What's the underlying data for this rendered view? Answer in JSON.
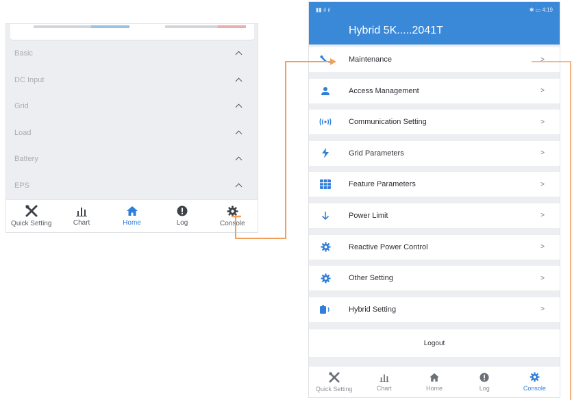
{
  "left_screen": {
    "sections": [
      {
        "label": "Basic",
        "icon": "chevron-up-icon"
      },
      {
        "label": "DC Input",
        "icon": "chevron-up-icon"
      },
      {
        "label": "Grid",
        "icon": "chevron-up-icon"
      },
      {
        "label": "Load",
        "icon": "chevron-up-icon"
      },
      {
        "label": "Battery",
        "icon": "chevron-up-icon"
      },
      {
        "label": "EPS",
        "icon": "chevron-up-icon"
      }
    ],
    "tabs": [
      {
        "label": "Quick Setting",
        "icon": "tools-icon",
        "active": false
      },
      {
        "label": "Chart",
        "icon": "bar-chart-icon",
        "active": false
      },
      {
        "label": "Home",
        "icon": "home-icon",
        "active": true
      },
      {
        "label": "Log",
        "icon": "info-icon",
        "active": false
      },
      {
        "label": "Console",
        "icon": "gear-icon",
        "active": false
      }
    ]
  },
  "right_screen": {
    "status": {
      "time": "4:19"
    },
    "header_title": "Hybrid 5K.....2041T",
    "menu": [
      {
        "label": "Maintenance",
        "icon": "wrench-icon",
        "chevron": ">"
      },
      {
        "label": "Access Management",
        "icon": "user-icon",
        "chevron": ">"
      },
      {
        "label": "Communication Setting",
        "icon": "signal-icon",
        "chevron": ">"
      },
      {
        "label": "Grid Parameters",
        "icon": "lightning-icon",
        "chevron": ">"
      },
      {
        "label": "Feature Parameters",
        "icon": "grid-icon",
        "chevron": ">"
      },
      {
        "label": "Power Limit",
        "icon": "arrow-down-icon",
        "chevron": ">"
      },
      {
        "label": "Reactive Power Control",
        "icon": "gear-icon",
        "chevron": ">"
      },
      {
        "label": "Other Setting",
        "icon": "gear-icon",
        "chevron": ">"
      },
      {
        "label": "Hybrid Setting",
        "icon": "battery-icon",
        "chevron": ">"
      }
    ],
    "logout_label": "Logout",
    "tabs": [
      {
        "label": "Quick Setting",
        "icon": "tools-icon",
        "active": false
      },
      {
        "label": "Chart",
        "icon": "bar-chart-icon",
        "active": false
      },
      {
        "label": "Home",
        "icon": "home-icon",
        "active": false
      },
      {
        "label": "Log",
        "icon": "info-icon",
        "active": false
      },
      {
        "label": "Console",
        "icon": "gear-icon",
        "active": true
      }
    ]
  },
  "colors": {
    "accent": "#3a88d8",
    "connector": "#f0a05a",
    "section_bg": "#eceef1"
  }
}
